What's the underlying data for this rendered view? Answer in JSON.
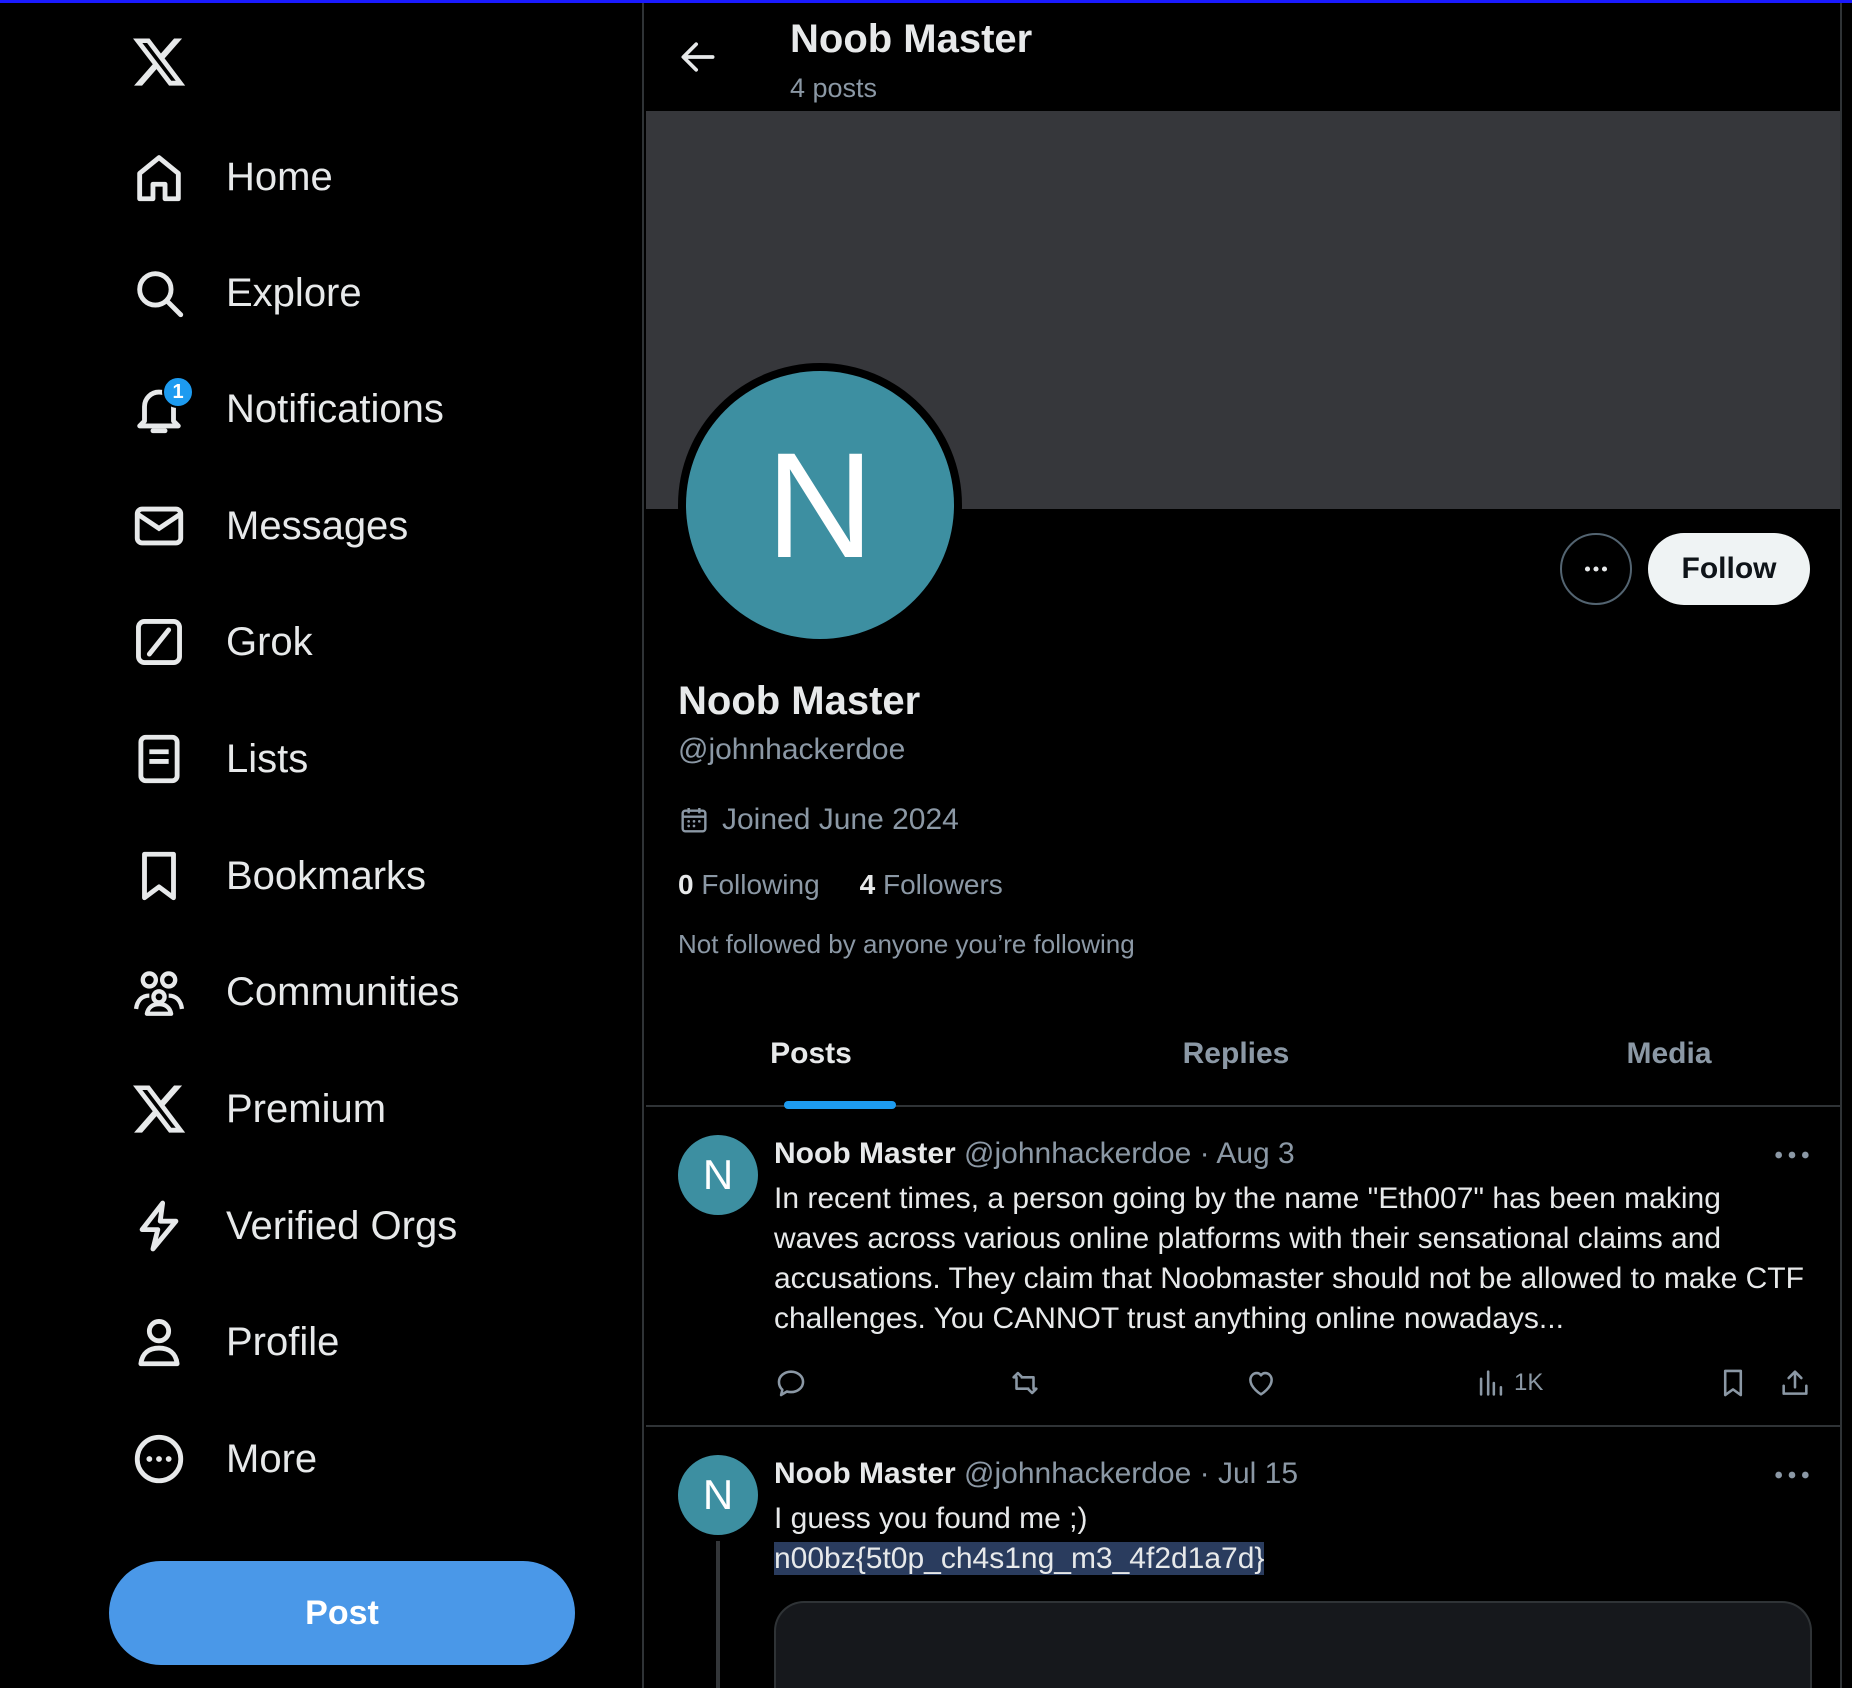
{
  "sidebar": {
    "logo": "x-logo-icon",
    "items": [
      {
        "label": "Home",
        "icon": "home-icon"
      },
      {
        "label": "Explore",
        "icon": "search-icon"
      },
      {
        "label": "Notifications",
        "icon": "bell-icon",
        "badge": "1"
      },
      {
        "label": "Messages",
        "icon": "envelope-icon"
      },
      {
        "label": "Grok",
        "icon": "grok-icon"
      },
      {
        "label": "Lists",
        "icon": "list-icon"
      },
      {
        "label": "Bookmarks",
        "icon": "bookmark-icon"
      },
      {
        "label": "Communities",
        "icon": "people-icon"
      },
      {
        "label": "Premium",
        "icon": "x-logo-icon"
      },
      {
        "label": "Verified Orgs",
        "icon": "lightning-icon"
      },
      {
        "label": "Profile",
        "icon": "person-icon"
      },
      {
        "label": "More",
        "icon": "more-circle-icon"
      }
    ],
    "post_label": "Post"
  },
  "header": {
    "title": "Noob Master",
    "subtitle": "4 posts"
  },
  "profile": {
    "avatar_letter": "N",
    "name": "Noob Master",
    "handle": "@johnhackerdoe",
    "joined": "Joined June 2024",
    "following_count": "0",
    "following_label": "Following",
    "followers_count": "4",
    "followers_label": "Followers",
    "not_followed": "Not followed by anyone you’re following",
    "follow_label": "Follow"
  },
  "tabs": [
    {
      "label": "Posts",
      "active": true
    },
    {
      "label": "Replies",
      "active": false
    },
    {
      "label": "Media",
      "active": false
    }
  ],
  "tweets": [
    {
      "avatar_letter": "N",
      "name": "Noob Master",
      "handle": "@johnhackerdoe",
      "dot": "·",
      "date": "Aug 3",
      "text": "In recent times, a person going by the name \"Eth007\" has been making waves across various online platforms with their sensational claims and accusations. They claim that Noobmaster should not be allowed to make CTF challenges. You CANNOT trust anything online nowadays...",
      "views": "1K"
    },
    {
      "avatar_letter": "N",
      "name": "Noob Master",
      "handle": "@johnhackerdoe",
      "dot": "·",
      "date": "Jul 15",
      "text_line1": "I guess you found me ;)",
      "text_line2": "n00bz{5t0p_ch4s1ng_m3_4f2d1a7d}"
    }
  ],
  "colors": {
    "accent": "#1d9bf0",
    "post_button": "#4a98e8",
    "avatar": "#3d8fa1",
    "banner": "#36373b",
    "muted_text": "#8b98a5"
  }
}
